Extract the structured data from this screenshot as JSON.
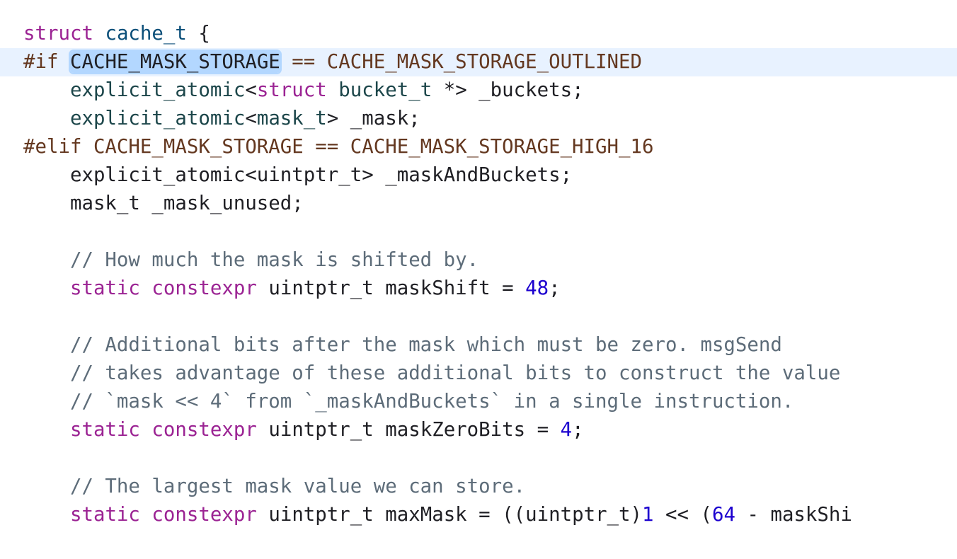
{
  "editor": {
    "lines": [
      [
        {
          "t": "struct",
          "c": "kw"
        },
        {
          "t": " ",
          "c": "pl"
        },
        {
          "t": "cache_t",
          "c": "ty"
        },
        {
          "t": " {",
          "c": "pl"
        }
      ],
      [
        {
          "t": "#if ",
          "c": "pp"
        },
        {
          "t": "CACHE_MASK_STORAGE",
          "c": "pl",
          "sel": true
        },
        {
          "t": " == CACHE_MASK_STORAGE_OUTLINED",
          "c": "pp"
        }
      ],
      [
        {
          "t": "    ",
          "c": "pl"
        },
        {
          "t": "explicit_atomic",
          "c": "ot"
        },
        {
          "t": "<",
          "c": "pl"
        },
        {
          "t": "struct",
          "c": "kw"
        },
        {
          "t": " ",
          "c": "pl"
        },
        {
          "t": "bucket_t",
          "c": "ot"
        },
        {
          "t": " *> _buckets;",
          "c": "pl"
        }
      ],
      [
        {
          "t": "    ",
          "c": "pl"
        },
        {
          "t": "explicit_atomic",
          "c": "ot"
        },
        {
          "t": "<",
          "c": "pl"
        },
        {
          "t": "mask_t",
          "c": "ot"
        },
        {
          "t": "> _mask;",
          "c": "pl"
        }
      ],
      [
        {
          "t": "#elif CACHE_MASK_STORAGE == CACHE_MASK_STORAGE_HIGH_16",
          "c": "pp"
        }
      ],
      [
        {
          "t": "    explicit_atomic<uintptr_t> _maskAndBuckets;",
          "c": "pl"
        }
      ],
      [
        {
          "t": "    mask_t _mask_unused;",
          "c": "pl"
        }
      ],
      [],
      [
        {
          "t": "    // How much the mask is shifted by.",
          "c": "cm"
        }
      ],
      [
        {
          "t": "    ",
          "c": "pl"
        },
        {
          "t": "static",
          "c": "kw"
        },
        {
          "t": " ",
          "c": "pl"
        },
        {
          "t": "constexpr",
          "c": "kw"
        },
        {
          "t": " uintptr_t maskShift = ",
          "c": "pl"
        },
        {
          "t": "48",
          "c": "nm"
        },
        {
          "t": ";",
          "c": "pl"
        }
      ],
      [],
      [
        {
          "t": "    // Additional bits after the mask which must be zero. msgSend",
          "c": "cm"
        }
      ],
      [
        {
          "t": "    // takes advantage of these additional bits to construct the value",
          "c": "cm"
        }
      ],
      [
        {
          "t": "    // `mask << 4` from `_maskAndBuckets` in a single instruction.",
          "c": "cm"
        }
      ],
      [
        {
          "t": "    ",
          "c": "pl"
        },
        {
          "t": "static",
          "c": "kw"
        },
        {
          "t": " ",
          "c": "pl"
        },
        {
          "t": "constexpr",
          "c": "kw"
        },
        {
          "t": " uintptr_t maskZeroBits = ",
          "c": "pl"
        },
        {
          "t": "4",
          "c": "nm"
        },
        {
          "t": ";",
          "c": "pl"
        }
      ],
      [],
      [
        {
          "t": "    // The largest mask value we can store.",
          "c": "cm"
        }
      ],
      [
        {
          "t": "    ",
          "c": "pl"
        },
        {
          "t": "static",
          "c": "kw"
        },
        {
          "t": " ",
          "c": "pl"
        },
        {
          "t": "constexpr",
          "c": "kw"
        },
        {
          "t": " uintptr_t maxMask = ((uintptr_t)",
          "c": "pl"
        },
        {
          "t": "1",
          "c": "nm"
        },
        {
          "t": " << (",
          "c": "pl"
        },
        {
          "t": "64",
          "c": "nm"
        },
        {
          "t": " - maskShi",
          "c": "pl"
        }
      ]
    ],
    "current_line": 1
  },
  "colors": {
    "keyword": "#9b2393",
    "preprocessor": "#643820",
    "type": "#0b4f79",
    "other_type": "#1c464a",
    "plain": "#1f1f24",
    "comment": "#5d6c79",
    "number": "#1c00cf",
    "selection": "#b3d7ff",
    "current_line": "#e8f2ff"
  }
}
